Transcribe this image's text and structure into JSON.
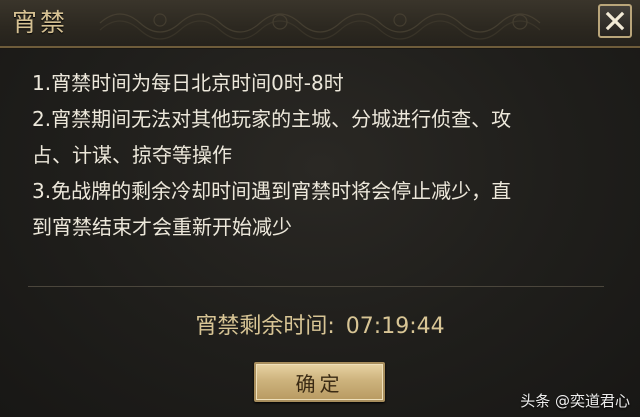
{
  "dialog": {
    "title": "宵禁",
    "close_icon": "close-icon"
  },
  "rules": [
    "1.宵禁时间为每日北京时间0时-8时",
    "2.宵禁期间无法对其他玩家的主城、分城进行侦查、攻",
    "占、计谋、掠夺等操作",
    "3.免战牌的剩余冷却时间遇到宵禁时将会停止减少，直",
    "到宵禁结束才会重新开始减少"
  ],
  "remaining": {
    "label": "宵禁剩余时间:",
    "value": "07:19:44"
  },
  "confirm_label": "确定",
  "watermark": "头条 @奕道君心",
  "colors": {
    "title": "#d6c193",
    "accent_gold": "#d8c595",
    "text": "#ece7da",
    "button": "#cdb37d"
  }
}
